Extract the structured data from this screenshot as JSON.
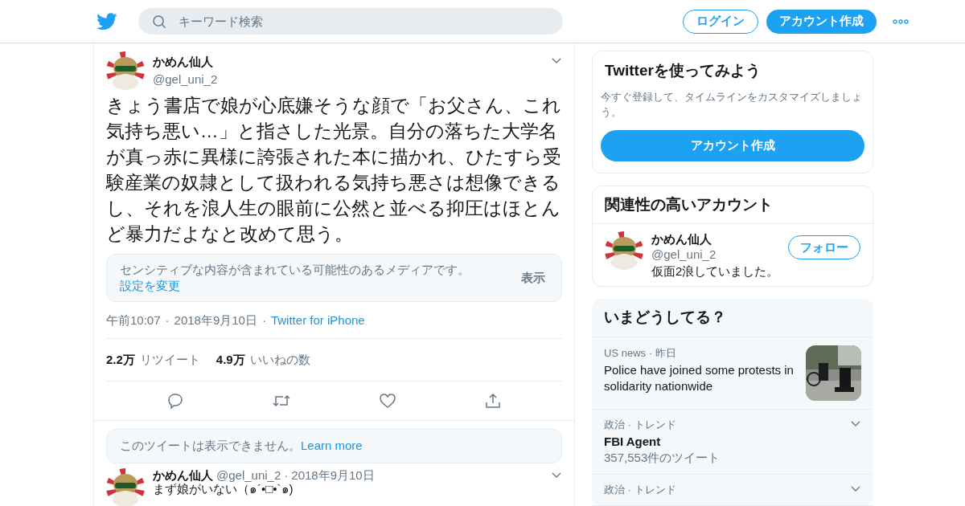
{
  "header": {
    "search": {
      "placeholder": "キーワード検索"
    },
    "login": "ログイン",
    "signup": "アカウント作成"
  },
  "tweet": {
    "name": "かめん仙人",
    "handle": "@gel_uni_2",
    "text": "きょう書店で娘が心底嫌そうな顔で「お父さん、これ気持ち悪い…」と指さした光景。自分の落ちた大学名が真っ赤に異様に誇張された本に描かれ、ひたすら受験産業の奴隷として扱われる気持ち悪さは想像できるし、それを浪人生の眼前に公然と並べる抑圧はほとんど暴力だよなと改めて思う。",
    "notice": {
      "text": "センシティブな内容が含まれている可能性のあるメディアです。",
      "link": "設定を変更",
      "action": "表示"
    },
    "time": "午前10:07",
    "sep": "·",
    "date": "2018年9月10日",
    "source": "Twitter for iPhone",
    "stats": [
      {
        "count": "2.2万",
        "label": "リツイート"
      },
      {
        "count": "4.9万",
        "label": "いいねの数"
      }
    ]
  },
  "unavailable": {
    "text": "このツイートは表示できません。",
    "link": "Learn more"
  },
  "reply": {
    "name": "かめん仙人",
    "handle": "@gel_uni_2",
    "sep": "·",
    "date": "2018年9月10日",
    "text": "まず娘がいない（๑´•□•`๑)"
  },
  "signup_card": {
    "title": "Twitterを使ってみよう",
    "text": "今すぐ登録して、タイムラインをカスタマイズしましょう。",
    "button": "アカウント作成"
  },
  "related": {
    "title": "関連性の高いアカウント",
    "accounts": [
      {
        "name": "かめん仙人",
        "handle": "@gel_uni_2",
        "bio": "仮面2浪していました。",
        "button": "フォロー"
      }
    ]
  },
  "trends": {
    "title": "いまどうしてる？",
    "items": [
      {
        "kind": "news",
        "meta": "US news",
        "sep": "·",
        "time": "昨日",
        "title": "Police have joined some protests in solidarity nationwide"
      },
      {
        "kind": "trend",
        "meta": "政治 · トレンド",
        "title": "FBI Agent",
        "count": "357,553件のツイート"
      },
      {
        "kind": "trend",
        "meta": "政治 · トレンド"
      }
    ]
  }
}
